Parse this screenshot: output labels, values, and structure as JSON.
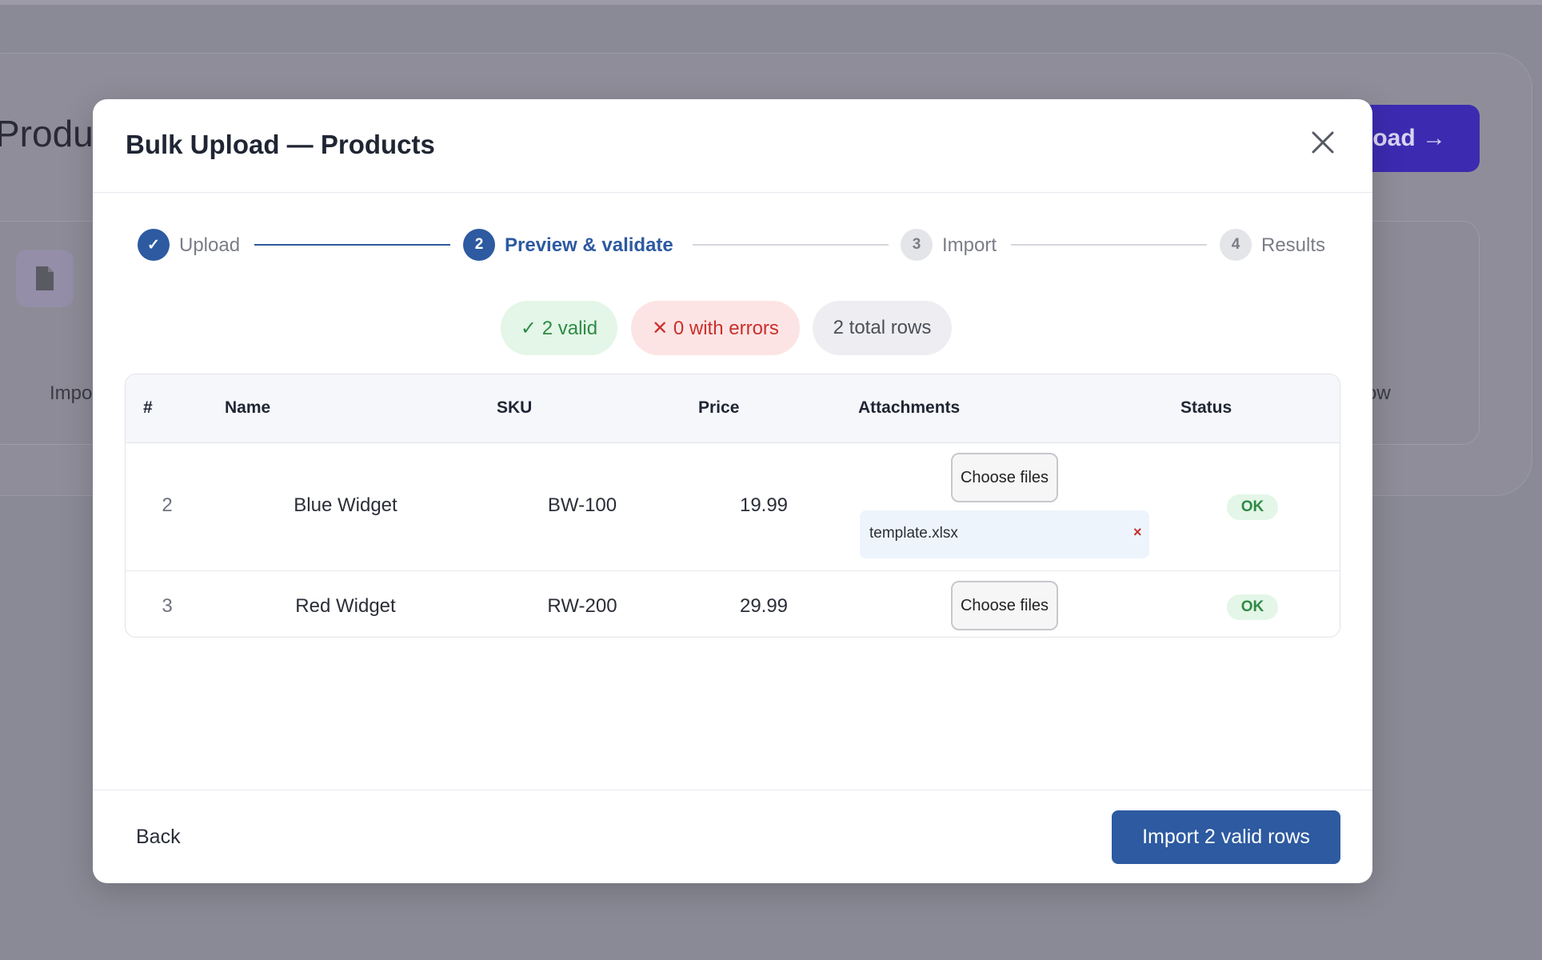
{
  "background": {
    "title": "Produc",
    "primary_button_label": "load →",
    "left_text": "Impo",
    "right_text": "ow",
    "file_icon": "file-icon"
  },
  "modal": {
    "title": "Bulk Upload — Products",
    "close_icon": "close-icon"
  },
  "stepper": {
    "steps": [
      {
        "marker": "✓",
        "label": "Upload",
        "state": "done"
      },
      {
        "marker": "2",
        "label": "Preview & validate",
        "state": "active"
      },
      {
        "marker": "3",
        "label": "Import",
        "state": "pending"
      },
      {
        "marker": "4",
        "label": "Results",
        "state": "pending"
      }
    ]
  },
  "summary": {
    "valid": "✓ 2 valid",
    "errors": "✕ 0 with errors",
    "total": "2 total rows"
  },
  "table": {
    "headers": [
      "#",
      "Name",
      "SKU",
      "Price",
      "Attachments",
      "Status"
    ],
    "rows": [
      {
        "num": "2",
        "name": "Blue Widget",
        "sku": "BW-100",
        "price": "19.99",
        "choose_label": "Choose files",
        "attachment": "template.xlsx",
        "remove_label": "×",
        "status": "OK"
      },
      {
        "num": "3",
        "name": "Red Widget",
        "sku": "RW-200",
        "price": "29.99",
        "choose_label": "Choose files",
        "status": "OK"
      }
    ]
  },
  "footer": {
    "back_label": "Back",
    "import_label": "Import 2 valid rows"
  },
  "colors": {
    "primary": "#2d5aa0",
    "success": "#2f8a45",
    "danger": "#c9302c",
    "overlay_button": "#3c2bb0"
  }
}
